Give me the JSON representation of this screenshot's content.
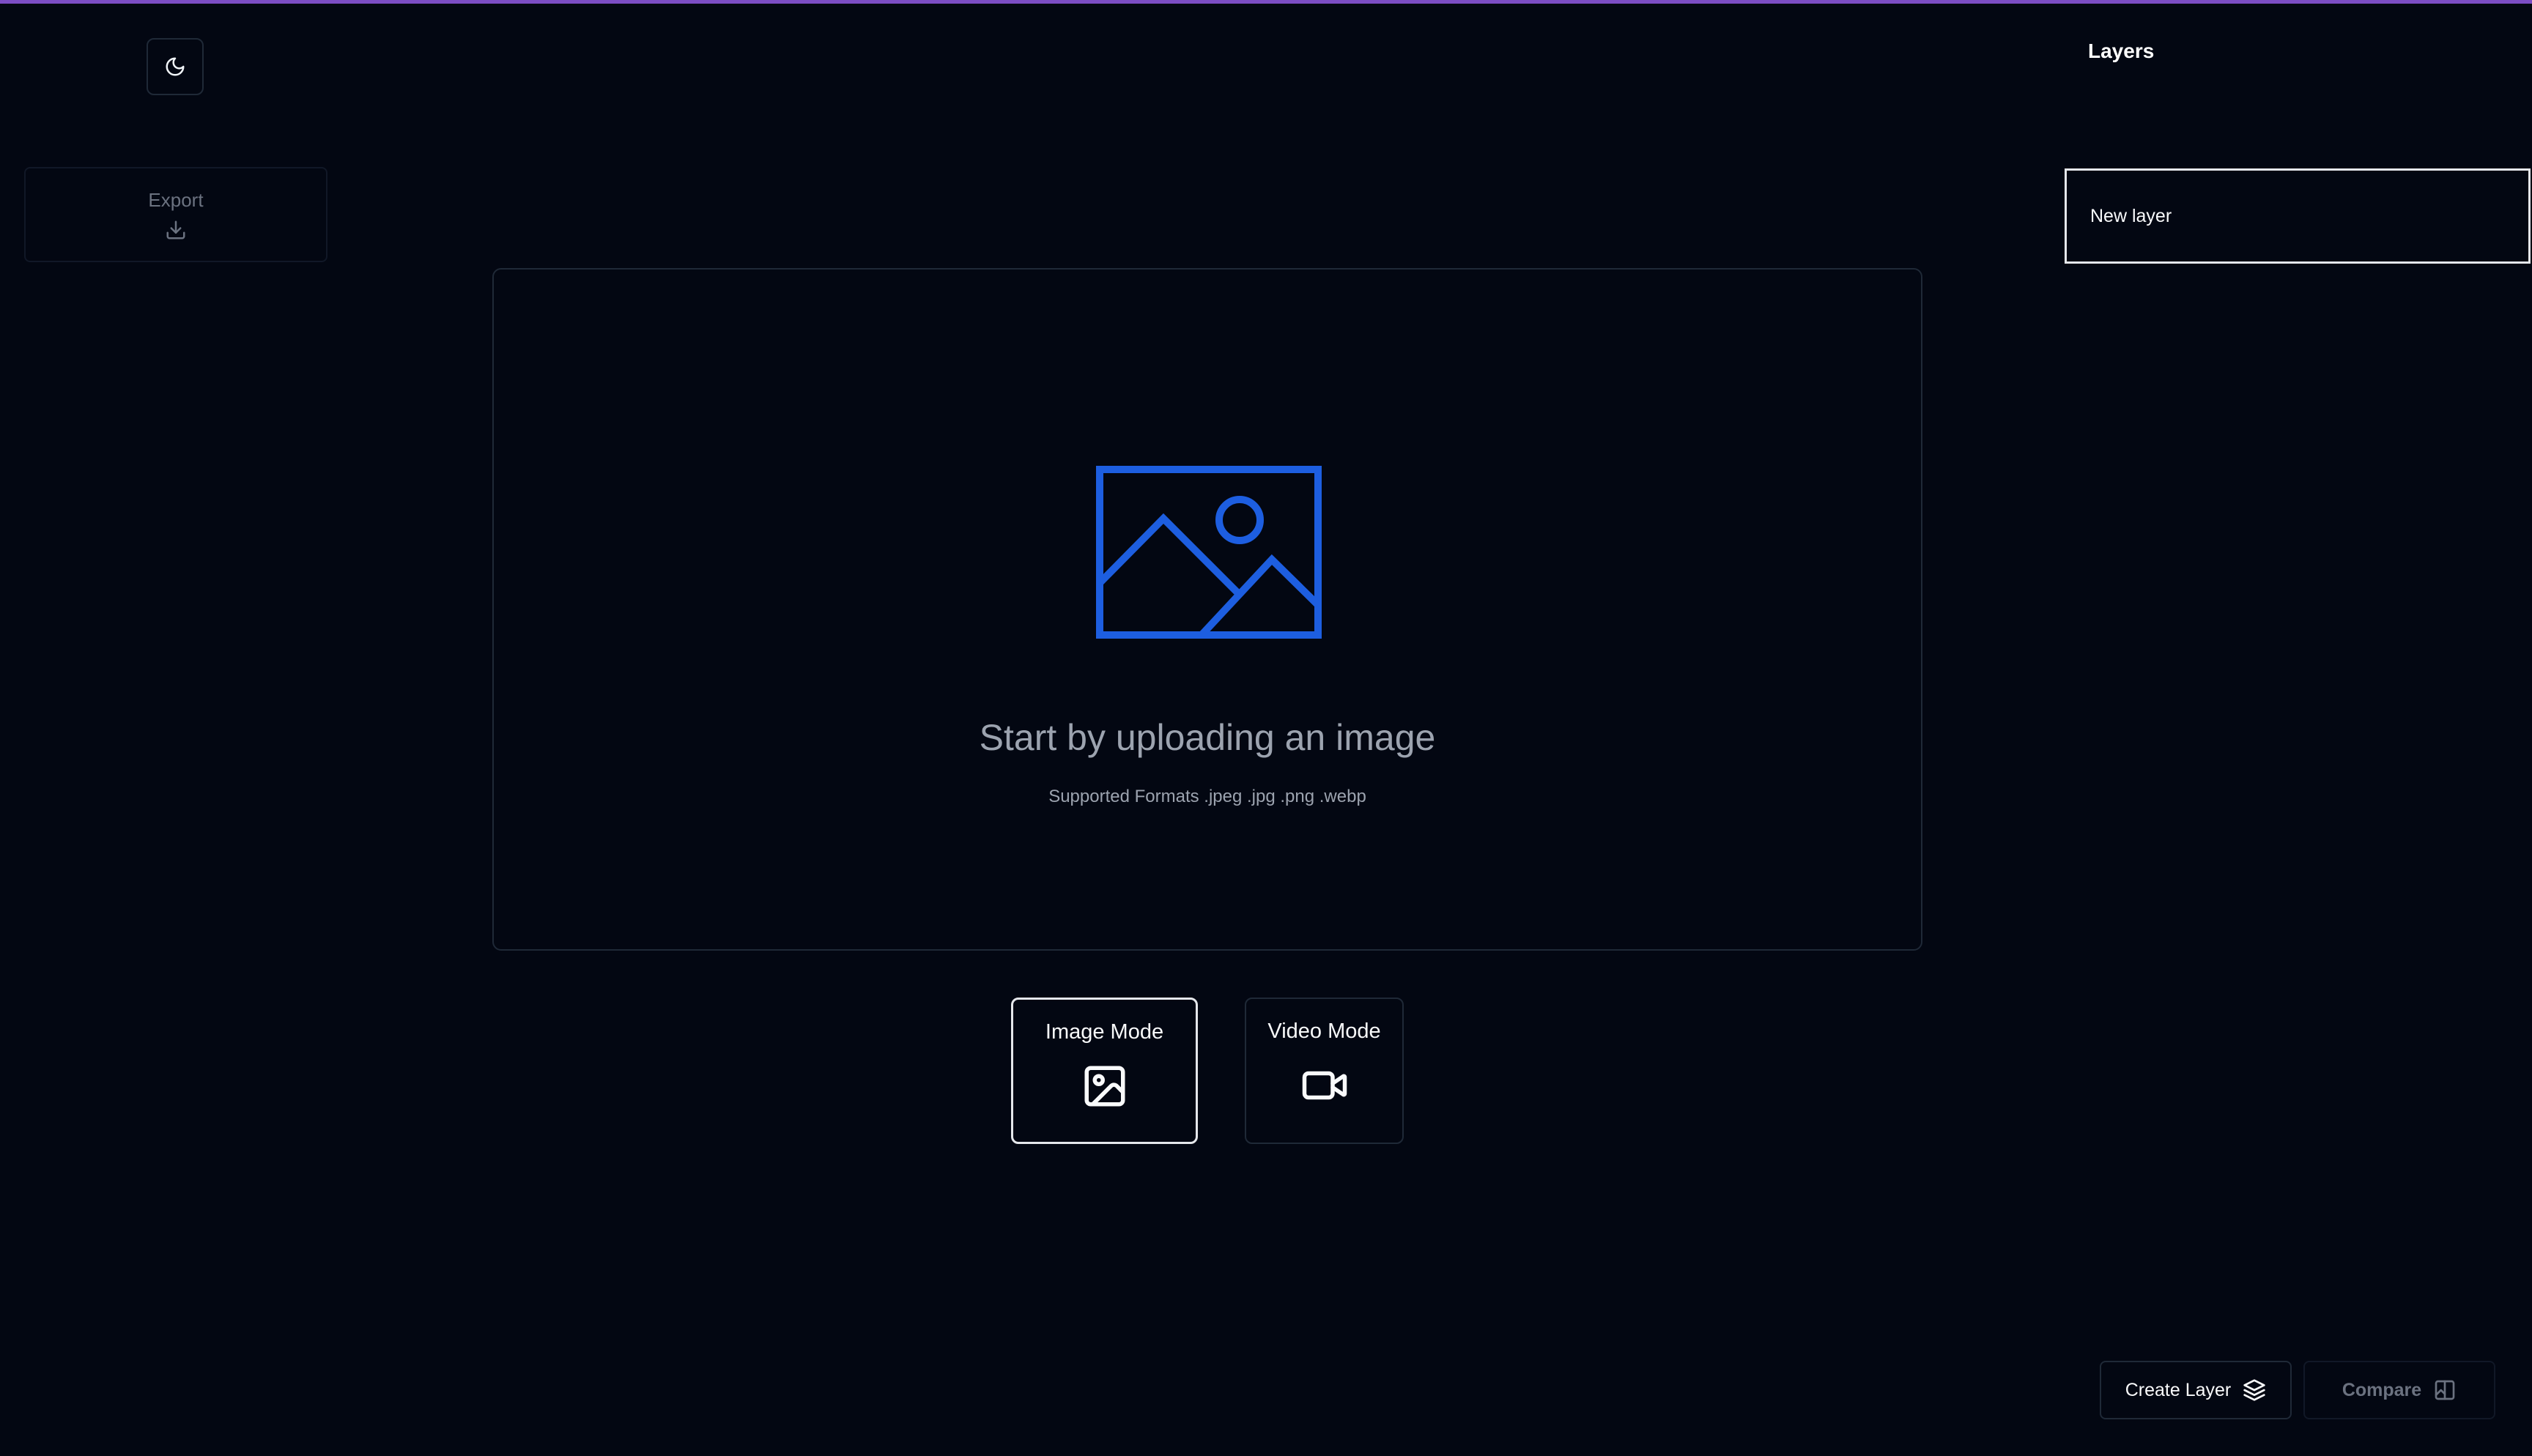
{
  "colors": {
    "background": "#030712",
    "accent_bar": "#7c4dc4",
    "upload_icon": "#1d5ee0",
    "muted_text": "#9ca3af"
  },
  "toolbar": {
    "theme_toggle_icon": "moon-icon",
    "export_label": "Export",
    "export_icon": "download-icon"
  },
  "layers_panel": {
    "title": "Layers",
    "items": [
      {
        "label": "New layer"
      }
    ]
  },
  "upload": {
    "icon": "image-icon",
    "heading": "Start by uploading an image",
    "formats": "Supported Formats .jpeg .jpg .png .webp"
  },
  "modes": [
    {
      "label": "Image Mode",
      "icon": "image-icon",
      "selected": true
    },
    {
      "label": "Video Mode",
      "icon": "video-camera-icon",
      "selected": false
    }
  ],
  "actions": {
    "create_layer_label": "Create Layer",
    "create_layer_icon": "layers-icon",
    "compare_label": "Compare",
    "compare_icon": "compare-image-icon"
  }
}
